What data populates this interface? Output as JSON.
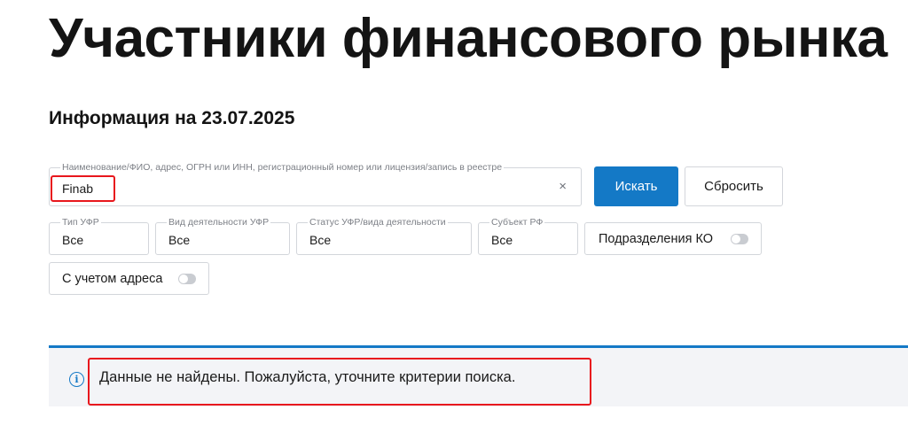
{
  "page": {
    "title": "Участники финансового рынка",
    "info_date": "Информация на 23.07.2025"
  },
  "search": {
    "legend": "Наименование/ФИО, адрес, ОГРН или ИНН, регистрационный номер или лицензия/запись в реестре",
    "value": "Finab",
    "clear_icon": "×",
    "search_label": "Искать",
    "reset_label": "Сбросить"
  },
  "filters": [
    {
      "legend": "Тип УФР",
      "value": "Все"
    },
    {
      "legend": "Вид деятельности УФР",
      "value": "Все"
    },
    {
      "legend": "Статус УФР/вида деятельности",
      "value": "Все"
    },
    {
      "legend": "Субъект РФ",
      "value": "Все"
    }
  ],
  "toggles": {
    "ko_divisions": {
      "label": "Подразделения КО",
      "on": false
    },
    "with_address": {
      "label": "С учетом адреса",
      "on": false
    }
  },
  "notice": {
    "icon": "i",
    "text": "Данные не найдены. Пожалуйста, уточните критерии поиска."
  },
  "colors": {
    "accent": "#1479c6",
    "highlight": "#e8171d",
    "notice_bg": "#f3f4f7"
  }
}
